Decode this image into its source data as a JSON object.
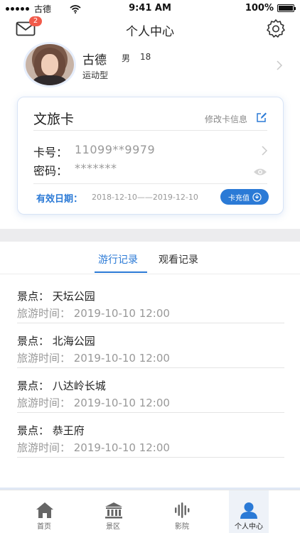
{
  "status_bar": {
    "carrier": "古德",
    "time": "9:41 AM",
    "battery": "100%",
    "battery_level": 1.0
  },
  "nav": {
    "title": "个人中心",
    "message_badge": "2"
  },
  "profile": {
    "name": "古德",
    "gender": "男",
    "age": "18",
    "tag": "运动型"
  },
  "card": {
    "title": "文旅卡",
    "edit_label": "修改卡信息",
    "card_number_label": "卡号：",
    "card_number": "11099**9979",
    "password_label": "密码：",
    "password": "*******",
    "valid_label": "有效日期：",
    "valid_dates": "2018-12-10——2019-12-10",
    "recharge_label": "卡充值"
  },
  "tabs": {
    "active": "游行记录",
    "inactive": "观看记录"
  },
  "records": [
    {
      "site": "景点：  天坛公园",
      "time": "旅游时间：  2019-10-10   12:00"
    },
    {
      "site": "景点：  北海公园",
      "time": "旅游时间：  2019-10-10   12:00"
    },
    {
      "site": "景点：  八达岭长城",
      "time": "旅游时间：  2019-10-10   12:00"
    },
    {
      "site": "景点：  恭王府",
      "time": "旅游时间：  2019-10-10   12:00"
    }
  ],
  "tab_bar": {
    "home": "首页",
    "scenic": "景区",
    "theater": "影院",
    "me": "个人中心"
  },
  "colors": {
    "accent": "#2b7ad6",
    "badge": "#f15a4a",
    "muted_text": "#999999"
  },
  "icons": [
    "mail-icon",
    "settings-icon",
    "chevron-right-icon",
    "edit-icon",
    "eye-icon",
    "recharge-icon",
    "home-icon",
    "scenic-icon",
    "theater-icon",
    "user-icon"
  ]
}
